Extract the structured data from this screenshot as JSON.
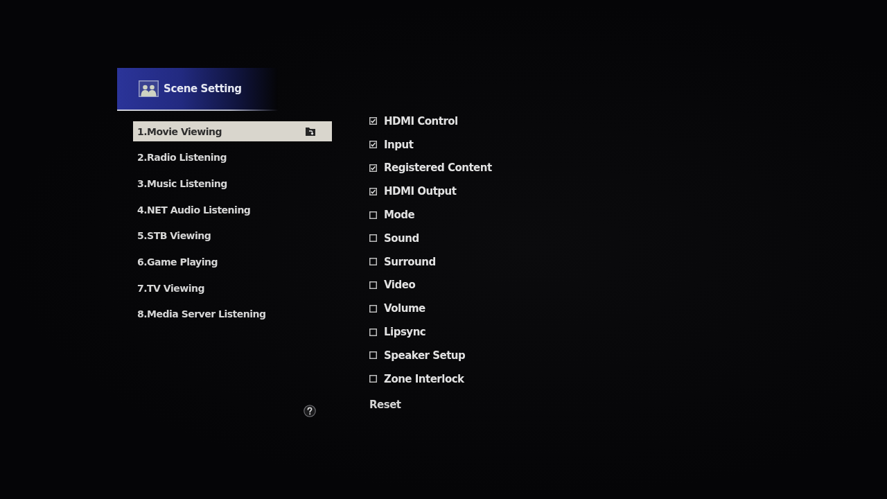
{
  "header": {
    "title": "Scene Setting"
  },
  "scenes": [
    {
      "label": "1.Movie Viewing",
      "selected": true
    },
    {
      "label": "2.Radio Listening",
      "selected": false
    },
    {
      "label": "3.Music Listening",
      "selected": false
    },
    {
      "label": "4.NET Audio Listening",
      "selected": false
    },
    {
      "label": "5.STB Viewing",
      "selected": false
    },
    {
      "label": "6.Game Playing",
      "selected": false
    },
    {
      "label": "7.TV Viewing",
      "selected": false
    },
    {
      "label": "8.Media Server Listening",
      "selected": false
    }
  ],
  "options": [
    {
      "label": "HDMI Control",
      "checked": true
    },
    {
      "label": "Input",
      "checked": true
    },
    {
      "label": "Registered Content",
      "checked": true
    },
    {
      "label": "HDMI Output",
      "checked": true
    },
    {
      "label": "Mode",
      "checked": false
    },
    {
      "label": "Sound",
      "checked": false
    },
    {
      "label": "Surround",
      "checked": false
    },
    {
      "label": "Video",
      "checked": false
    },
    {
      "label": "Volume",
      "checked": false
    },
    {
      "label": "Lipsync",
      "checked": false
    },
    {
      "label": "Speaker Setup",
      "checked": false
    },
    {
      "label": "Zone Interlock",
      "checked": false
    }
  ],
  "reset": {
    "label": "Reset"
  }
}
